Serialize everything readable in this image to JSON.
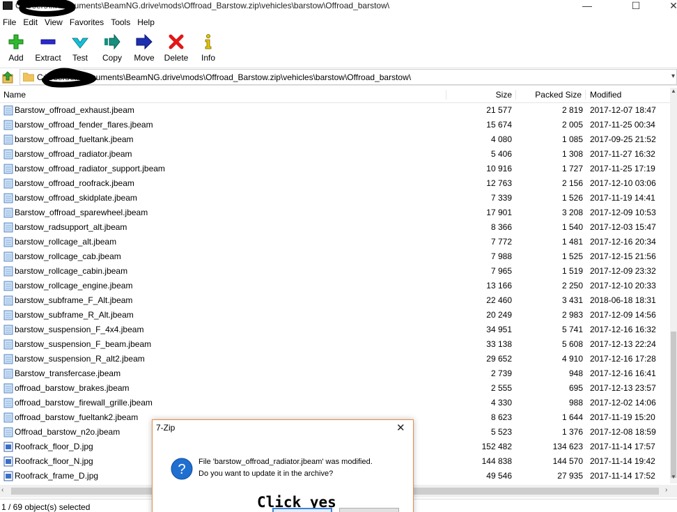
{
  "window": {
    "title": "C:\\Users\\...\\Documents\\BeamNG.drive\\mods\\Offroad_Barstow.zip\\vehicles\\barstow\\Offroad_barstow\\",
    "min": "—",
    "max": "☐",
    "close": "✕"
  },
  "menu": [
    "File",
    "Edit",
    "View",
    "Favorites",
    "Tools",
    "Help"
  ],
  "toolbar": [
    {
      "label": "Add",
      "icon": "plus-icon",
      "color": "#2fb82f"
    },
    {
      "label": "Extract",
      "icon": "minus-icon",
      "color": "#2a2ad0"
    },
    {
      "label": "Test",
      "icon": "check-icon",
      "color": "#16c0d8"
    },
    {
      "label": "Copy",
      "icon": "copy-arrow-icon",
      "color": "#178f7f"
    },
    {
      "label": "Move",
      "icon": "move-arrow-icon",
      "color": "#1d2fb0"
    },
    {
      "label": "Delete",
      "icon": "delete-x-icon",
      "color": "#e21616"
    },
    {
      "label": "Info",
      "icon": "info-icon",
      "color": "#e2c400"
    }
  ],
  "address": {
    "path": "C:\\Users\\...\\Documents\\BeamNG.drive\\mods\\Offroad_Barstow.zip\\vehicles\\barstow\\Offroad_barstow\\"
  },
  "columns": {
    "name": "Name",
    "size": "Size",
    "packed": "Packed Size",
    "modified": "Modified"
  },
  "files": [
    {
      "name": "Barstow_offroad_exhaust.jbeam",
      "size": "21 577",
      "packed": "2 819",
      "modified": "2017-12-07 18:47",
      "icon": "jbeam-file-icon"
    },
    {
      "name": "barstow_offroad_fender_flares.jbeam",
      "size": "15 674",
      "packed": "2 005",
      "modified": "2017-11-25 00:34",
      "icon": "jbeam-file-icon"
    },
    {
      "name": "barstow_offroad_fueltank.jbeam",
      "size": "4 080",
      "packed": "1 085",
      "modified": "2017-09-25 21:52",
      "icon": "jbeam-file-icon"
    },
    {
      "name": "barstow_offroad_radiator.jbeam",
      "size": "5 406",
      "packed": "1 308",
      "modified": "2017-11-27 16:32",
      "icon": "jbeam-file-icon"
    },
    {
      "name": "barstow_offroad_radiator_support.jbeam",
      "size": "10 916",
      "packed": "1 727",
      "modified": "2017-11-25 17:19",
      "icon": "jbeam-file-icon"
    },
    {
      "name": "barstow_offroad_roofrack.jbeam",
      "size": "12 763",
      "packed": "2 156",
      "modified": "2017-12-10 03:06",
      "icon": "jbeam-file-icon"
    },
    {
      "name": "barstow_offroad_skidplate.jbeam",
      "size": "7 339",
      "packed": "1 526",
      "modified": "2017-11-19 14:41",
      "icon": "jbeam-file-icon"
    },
    {
      "name": "Barstow_offroad_sparewheel.jbeam",
      "size": "17 901",
      "packed": "3 208",
      "modified": "2017-12-09 10:53",
      "icon": "jbeam-file-icon"
    },
    {
      "name": "barstow_radsupport_alt.jbeam",
      "size": "8 366",
      "packed": "1 540",
      "modified": "2017-12-03 15:47",
      "icon": "jbeam-file-icon"
    },
    {
      "name": "barstow_rollcage_alt.jbeam",
      "size": "7 772",
      "packed": "1 481",
      "modified": "2017-12-16 20:34",
      "icon": "jbeam-file-icon"
    },
    {
      "name": "barstow_rollcage_cab.jbeam",
      "size": "7 988",
      "packed": "1 525",
      "modified": "2017-12-15 21:56",
      "icon": "jbeam-file-icon"
    },
    {
      "name": "barstow_rollcage_cabin.jbeam",
      "size": "7 965",
      "packed": "1 519",
      "modified": "2017-12-09 23:32",
      "icon": "jbeam-file-icon"
    },
    {
      "name": "barstow_rollcage_engine.jbeam",
      "size": "13 166",
      "packed": "2 250",
      "modified": "2017-12-10 20:33",
      "icon": "jbeam-file-icon"
    },
    {
      "name": "barstow_subframe_F_Alt.jbeam",
      "size": "22 460",
      "packed": "3 431",
      "modified": "2018-06-18 18:31",
      "icon": "jbeam-file-icon"
    },
    {
      "name": "barstow_subframe_R_Alt.jbeam",
      "size": "20 249",
      "packed": "2 983",
      "modified": "2017-12-09 14:56",
      "icon": "jbeam-file-icon"
    },
    {
      "name": "barstow_suspension_F_4x4.jbeam",
      "size": "34 951",
      "packed": "5 741",
      "modified": "2017-12-16 16:32",
      "icon": "jbeam-file-icon"
    },
    {
      "name": "barstow_suspension_F_beam.jbeam",
      "size": "33 138",
      "packed": "5 608",
      "modified": "2017-12-13 22:24",
      "icon": "jbeam-file-icon"
    },
    {
      "name": "barstow_suspension_R_alt2.jbeam",
      "size": "29 652",
      "packed": "4 910",
      "modified": "2017-12-16 17:28",
      "icon": "jbeam-file-icon"
    },
    {
      "name": "Barstow_transfercase.jbeam",
      "size": "2 739",
      "packed": "948",
      "modified": "2017-12-16 16:41",
      "icon": "jbeam-file-icon"
    },
    {
      "name": "offroad_barstow_brakes.jbeam",
      "size": "2 555",
      "packed": "695",
      "modified": "2017-12-13 23:57",
      "icon": "jbeam-file-icon"
    },
    {
      "name": "offroad_barstow_firewall_grille.jbeam",
      "size": "4 330",
      "packed": "988",
      "modified": "2017-12-02 14:06",
      "icon": "jbeam-file-icon"
    },
    {
      "name": "offroad_barstow_fueltank2.jbeam",
      "size": "8 623",
      "packed": "1 644",
      "modified": "2017-11-19 15:20",
      "icon": "jbeam-file-icon"
    },
    {
      "name": "Offroad_barstow_n2o.jbeam",
      "size": "5 523",
      "packed": "1 376",
      "modified": "2017-12-08 18:59",
      "icon": "jbeam-file-icon"
    },
    {
      "name": "Roofrack_floor_D.jpg",
      "size": "152 482",
      "packed": "134 623",
      "modified": "2017-11-14 17:57",
      "icon": "image-file-icon"
    },
    {
      "name": "Roofrack_floor_N.jpg",
      "size": "144 838",
      "packed": "144 570",
      "modified": "2017-11-14 19:42",
      "icon": "image-file-icon"
    },
    {
      "name": "Roofrack_frame_D.jpg",
      "size": "49 546",
      "packed": "27 935",
      "modified": "2017-11-14 17:52",
      "icon": "image-file-icon"
    }
  ],
  "status": {
    "text": "1 / 69 object(s) selected"
  },
  "dialog": {
    "title": "7-Zip",
    "close": "✕",
    "line1": "File 'barstow_offroad_radiator.jbeam' was modified.",
    "line2": "Do you want to update it in the archive?",
    "annotation": "Click yes"
  }
}
